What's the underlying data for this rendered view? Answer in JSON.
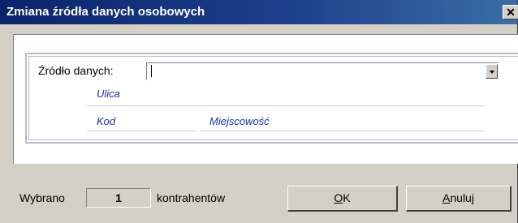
{
  "window": {
    "title": "Zmiana źródła danych osobowych",
    "close_glyph": "✕"
  },
  "form": {
    "source_label": "Źródło danych:",
    "source_value": "",
    "street_label": "Ulica",
    "zip_label": "Kod",
    "city_label": "Miejscowość"
  },
  "footer": {
    "selected_prefix": "Wybrano",
    "selected_count": "1",
    "selected_suffix": "kontrahentów",
    "ok_label_mnemonic": "O",
    "ok_label_rest": "K",
    "cancel_label_mnemonic": "A",
    "cancel_label_rest": "nuluj"
  },
  "colors": {
    "title_bar": "#0a246a",
    "window_face": "#d4d0c8",
    "field_label": "#1c2fa0"
  }
}
